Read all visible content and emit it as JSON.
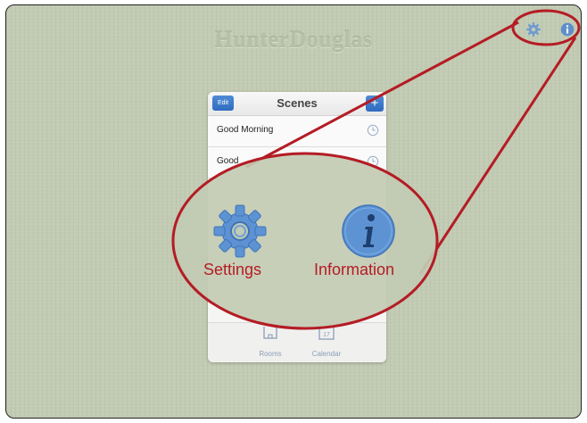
{
  "brand": {
    "text": "HunterDouglas"
  },
  "toolbar": {
    "settings_icon": "gear-icon",
    "info_icon": "info-icon"
  },
  "scenes_panel": {
    "edit_label": "Edit",
    "title": "Scenes",
    "add_label": "+",
    "scenes": [
      {
        "name": "Good Morning"
      },
      {
        "name": "Good"
      }
    ],
    "tabs": [
      {
        "label": "Rooms",
        "icon": "rooms-icon"
      },
      {
        "label": "Calendar",
        "icon": "calendar-icon",
        "icon_text": "17"
      }
    ]
  },
  "callout": {
    "settings_label": "Settings",
    "information_label": "Information"
  },
  "colors": {
    "annotation": "#b41c24",
    "accent": "#3a74c8",
    "background": "#c2cbb3"
  }
}
